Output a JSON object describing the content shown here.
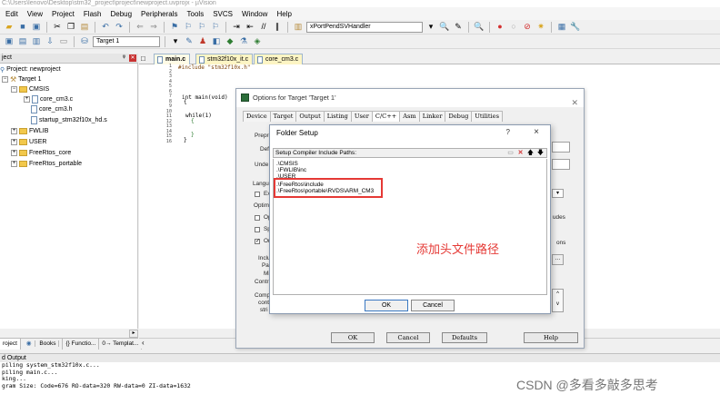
{
  "window": {
    "title_partial": "C:\\Users\\lenovo\\Desktop\\stm32_project\\project\\newproject.uvprojx - µVision"
  },
  "menu": [
    "Edit",
    "View",
    "Project",
    "Flash",
    "Debug",
    "Peripherals",
    "Tools",
    "SVCS",
    "Window",
    "Help"
  ],
  "toolbar": {
    "function_combo": "xPortPendSVHandler",
    "target_combo": "Target 1"
  },
  "project_panel": {
    "title": "ject",
    "tree": {
      "project": "Project: newproject",
      "target": "Target 1",
      "groups": [
        "CMSIS",
        "FWLIB",
        "USER",
        "FreeRtos_core",
        "FreeRtos_portable"
      ],
      "cmsis_files": [
        "core_cm3.c",
        "core_cm3.h",
        "startup_stm32f10x_hd.s"
      ]
    },
    "bottom_tabs": [
      "roject",
      "Books",
      "{} Functio...",
      "0→ Templat..."
    ]
  },
  "editor": {
    "tabs": [
      "main.c",
      "stm32f10x_it.c",
      "core_cm3.c"
    ],
    "line_numbers": [
      "1",
      "2",
      "3",
      "4",
      "5",
      "6",
      "7",
      "8",
      "9",
      "10",
      "11",
      "12",
      "13",
      "14",
      "15",
      "16"
    ],
    "code": [
      "#include \"stm32f10x.h\"",
      "int main(void)",
      "{",
      "while(1)",
      "{",
      "}",
      "}"
    ]
  },
  "options_dialog": {
    "title": "Options for Target 'Target 1'",
    "tabs": [
      "Device",
      "Target",
      "Output",
      "Listing",
      "User",
      "C/C++",
      "Asm",
      "Linker",
      "Debug",
      "Utilities"
    ],
    "active_tab": "C/C++",
    "fragments": [
      "Prepro",
      "Def",
      "Unde",
      "Langu",
      "Ex",
      "Optimiz",
      "Op",
      "Sp",
      "On",
      "Inclu",
      "Pat",
      "Mi",
      "Contr",
      "Comp",
      "cont",
      "stri",
      "udes",
      "ons"
    ],
    "buttons": [
      "OK",
      "Cancel",
      "Defaults",
      "Help"
    ]
  },
  "folder_setup": {
    "title": "Folder Setup",
    "help": "?",
    "close": "×",
    "header": "Setup Compiler Include Paths:",
    "paths": [
      ".\\CMSIS",
      ".\\FWLIB\\inc",
      ".\\USER",
      ".\\FreeRtos\\include",
      ".\\FreeRtos\\portable\\RVDS\\ARM_CM3"
    ],
    "buttons": [
      "OK",
      "Cancel"
    ]
  },
  "annotation": "添加头文件路径",
  "output_panel": {
    "title": "d Output",
    "lines": [
      "piling system_stm32f10x.c...",
      "piling main.c...",
      "king...",
      "gram Size: Code=676 RO-data=320 RW-data=0 ZI-data=1632"
    ]
  },
  "watermark": "CSDN @多看多敲多思考",
  "colors": {
    "highlight_red": "#e53935",
    "tab_active": "#fffbe6",
    "tab_file": "#fdf5c4"
  }
}
